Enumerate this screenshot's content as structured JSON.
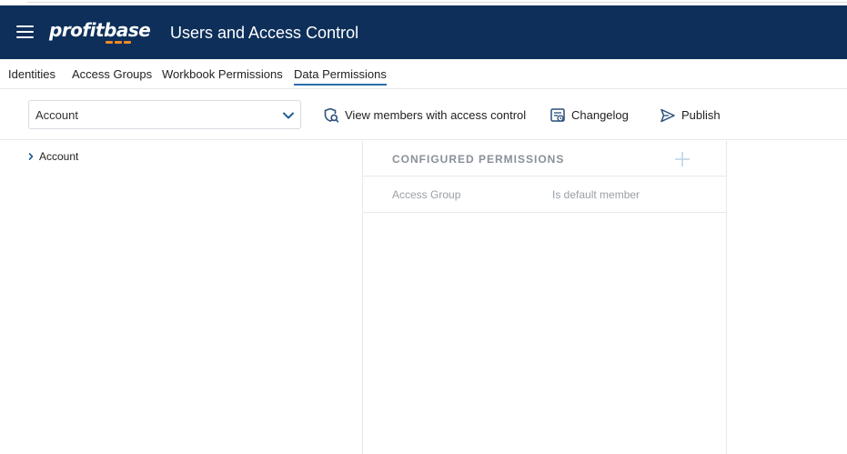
{
  "header": {
    "brand": "profitbase",
    "title": "Users and Access Control",
    "colors": {
      "background": "#0d2f5a",
      "brand_accent": "#f08a24"
    }
  },
  "tabs": [
    {
      "label": "Identities",
      "active": false
    },
    {
      "label": "Access Groups",
      "active": false
    },
    {
      "label": "Workbook Permissions",
      "active": false
    },
    {
      "label": "Data Permissions",
      "active": true
    }
  ],
  "toolbar": {
    "dimension_select": {
      "value": "Account",
      "icon": "chevron-down-icon"
    },
    "view_members_label": "View members with access control",
    "changelog_label": "Changelog",
    "publish_label": "Publish"
  },
  "tree": {
    "items": [
      {
        "label": "Account",
        "icon": "chevron-right-icon",
        "expanded": false
      }
    ]
  },
  "permissions_panel": {
    "title": "CONFIGURED PERMISSIONS",
    "add_icon": "plus-icon",
    "columns": [
      "Access Group",
      "Is default member"
    ]
  }
}
